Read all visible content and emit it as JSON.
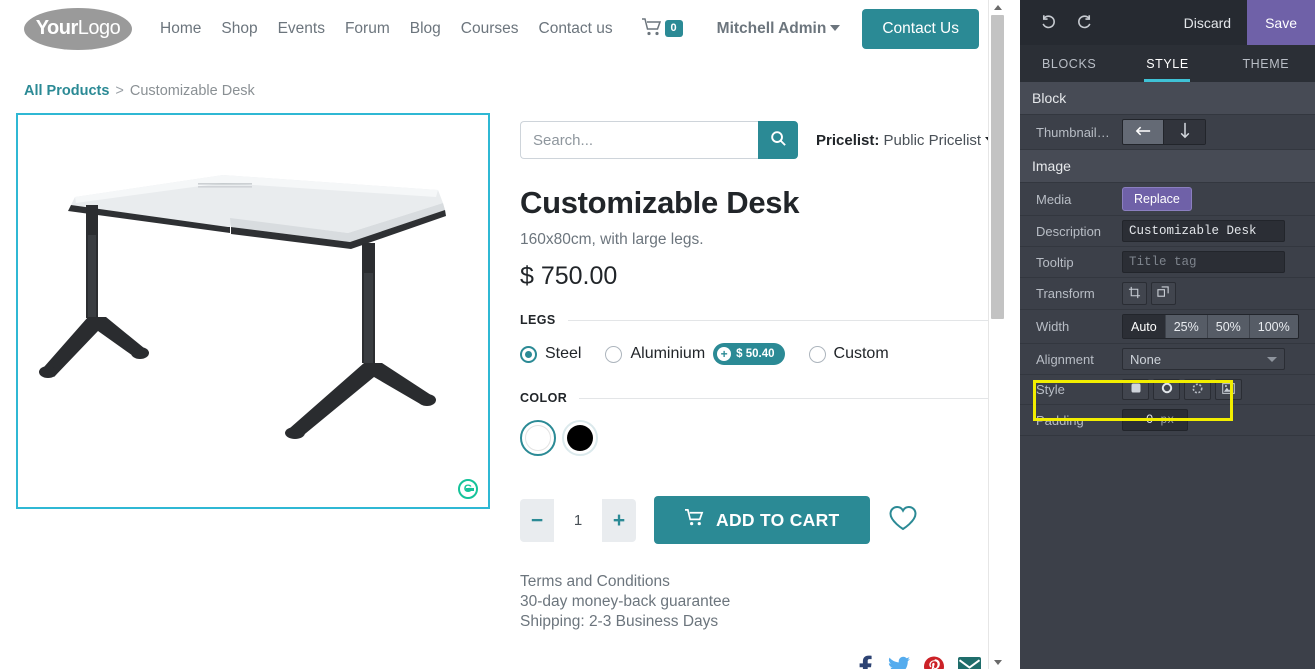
{
  "site": {
    "logo_text_bold": "Your",
    "logo_text_light": "Logo",
    "nav_links": [
      "Home",
      "Shop",
      "Events",
      "Forum",
      "Blog",
      "Courses",
      "Contact us"
    ],
    "cart_count": "0",
    "user_name": "Mitchell Admin",
    "contact_button": "Contact Us"
  },
  "breadcrumb": {
    "root": "All Products",
    "separator": ">",
    "current": "Customizable Desk"
  },
  "search": {
    "placeholder": "Search...",
    "value": "",
    "icon": "search-icon"
  },
  "pricelist": {
    "label": "Pricelist:",
    "value": "Public Pricelist"
  },
  "product": {
    "title": "Customizable Desk",
    "subtitle": "160x80cm, with large legs.",
    "price": "$ 750.00",
    "image_alt": "Customizable Desk white L-shaped desk with black legs",
    "legs": {
      "label": "LEGS",
      "options": [
        {
          "label": "Steel",
          "selected": true,
          "extra": null
        },
        {
          "label": "Aluminium",
          "selected": false,
          "extra": "$ 50.40"
        },
        {
          "label": "Custom",
          "selected": false,
          "extra": null
        }
      ]
    },
    "color": {
      "label": "COLOR",
      "options": [
        {
          "name": "white",
          "hex": "#ffffff",
          "selected": true
        },
        {
          "name": "black",
          "hex": "#000000",
          "selected": false
        }
      ]
    },
    "quantity": "1",
    "decrease_label": "−",
    "increase_label": "+",
    "add_to_cart": "ADD TO CART",
    "wishlist_icon": "heart-icon",
    "terms": [
      "Terms and Conditions",
      "30-day money-back guarantee",
      "Shipping: 2-3 Business Days"
    ],
    "socials": [
      "facebook-icon",
      "twitter-icon",
      "pinterest-icon",
      "email-icon"
    ]
  },
  "editor": {
    "undo_icon": "undo-icon",
    "redo_icon": "redo-icon",
    "discard": "Discard",
    "save": "Save",
    "tabs": [
      {
        "label": "BLOCKS",
        "active": false
      },
      {
        "label": "STYLE",
        "active": true
      },
      {
        "label": "THEME",
        "active": false
      }
    ],
    "block_section": {
      "title": "Block",
      "thumbnails_position": {
        "label": "Thumbnails Posi...",
        "options": [
          {
            "icon": "arrow-left-icon",
            "selected": true
          },
          {
            "icon": "arrow-down-icon",
            "selected": false
          }
        ]
      }
    },
    "image_section": {
      "title": "Image",
      "media": {
        "label": "Media",
        "button": "Replace"
      },
      "description": {
        "label": "Description",
        "value": "Customizable Desk",
        "placeholder": ""
      },
      "tooltip": {
        "label": "Tooltip",
        "value": "",
        "placeholder": "Title tag"
      },
      "transform": {
        "label": "Transform",
        "buttons": [
          {
            "icon": "crop-icon"
          },
          {
            "icon": "transform-icon"
          }
        ]
      },
      "width": {
        "label": "Width",
        "options": [
          {
            "label": "Auto",
            "selected": true
          },
          {
            "label": "25%",
            "selected": false
          },
          {
            "label": "50%",
            "selected": false
          },
          {
            "label": "100%",
            "selected": false
          }
        ]
      },
      "alignment": {
        "label": "Alignment",
        "value": "None"
      },
      "style": {
        "label": "Style",
        "buttons": [
          {
            "icon": "rounded-square-icon"
          },
          {
            "icon": "circle-icon"
          },
          {
            "icon": "shadow-icon"
          },
          {
            "icon": "thumbnail-icon"
          }
        ]
      },
      "padding": {
        "label": "Padding",
        "value": "0",
        "unit": "px"
      }
    },
    "colors": {
      "save_button": "#6f61a8",
      "tab_underline": "#3fc2d6",
      "panel_bg": "#3c4049",
      "highlight": "#f2ee00"
    }
  }
}
